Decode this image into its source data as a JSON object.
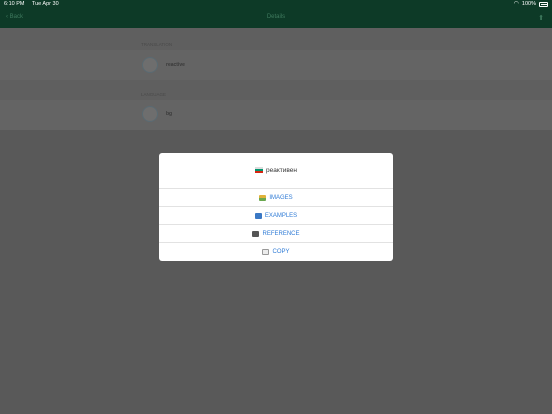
{
  "status_bar": {
    "time": "6:10 PM",
    "date": "Tue Apr 30",
    "battery": "100%"
  },
  "nav": {
    "back_label": "Back",
    "title": "Details",
    "action_icon": "share-icon"
  },
  "list": {
    "section1": {
      "header": "TRANSLATION",
      "row_label": "reactive"
    },
    "section2": {
      "header": "LANGUAGE",
      "row_label": "bg"
    }
  },
  "dialog": {
    "title": "реактивен",
    "actions": {
      "images": "IMAGES",
      "examples": "EXAMPLES",
      "reference": "REFERENCE",
      "copy": "COPY"
    }
  },
  "colors": {
    "accent": "#2f7bd6",
    "nav_bg": "#0d3a27",
    "overlay": "#5a5a5a"
  }
}
